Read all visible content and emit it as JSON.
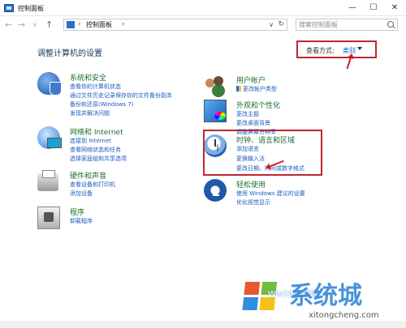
{
  "window": {
    "title": "控制面板",
    "minimize": "—",
    "maximize": "☐",
    "close": "✕"
  },
  "nav": {
    "back": "←",
    "forward": "→",
    "recent": "∨",
    "up": "↑"
  },
  "address": {
    "separator": "›",
    "crumb": "控制面板",
    "separator2": "›",
    "dropdown": "∨",
    "refresh": "↻"
  },
  "search": {
    "placeholder": "搜索控制面板"
  },
  "page": {
    "title": "调整计算机的设置"
  },
  "view_by": {
    "label": "查看方式:",
    "value": "类别"
  },
  "categories_left": [
    {
      "title": "系统和安全",
      "icon": "shield-icon",
      "links": [
        "查看你的计算机状态",
        "通过文件历史记录保存你的文件备份副本",
        "备份和还原(Windows 7)",
        "发现并解决问题"
      ]
    },
    {
      "title": "网络和 Internet",
      "icon": "network-globe-icon",
      "links": [
        "连接到 Internet",
        "查看网络状态和任务",
        "选择家庭组和共享选项"
      ]
    },
    {
      "title": "硬件和声音",
      "icon": "printer-icon",
      "links": [
        "查看设备和打印机",
        "添加设备"
      ]
    },
    {
      "title": "程序",
      "icon": "programs-icon",
      "links": [
        "卸载程序"
      ]
    }
  ],
  "categories_right": [
    {
      "title": "用户帐户",
      "icon": "users-icon",
      "links": [
        "更改帐户类型"
      ]
    },
    {
      "title": "外观和个性化",
      "icon": "appearance-icon",
      "links": [
        "更改主题",
        "更改桌面背景",
        "调整屏幕分辨率"
      ]
    },
    {
      "title": "时钟、语言和区域",
      "icon": "clock-globe-icon",
      "links": [
        "添加语言",
        "更换输入法",
        "更改日期、时间或数字格式"
      ]
    },
    {
      "title": "轻松使用",
      "icon": "ease-of-access-icon",
      "links": [
        "使用 Windows 建议的设置",
        "优化视觉显示"
      ]
    }
  ],
  "watermark": {
    "brand": "系统城",
    "site": "Win10系统城",
    "url": "xitongcheng.com"
  },
  "colors": {
    "category_title": "#1e6e2f",
    "link": "#1a5bbf",
    "annotation_red": "#c0262e"
  }
}
